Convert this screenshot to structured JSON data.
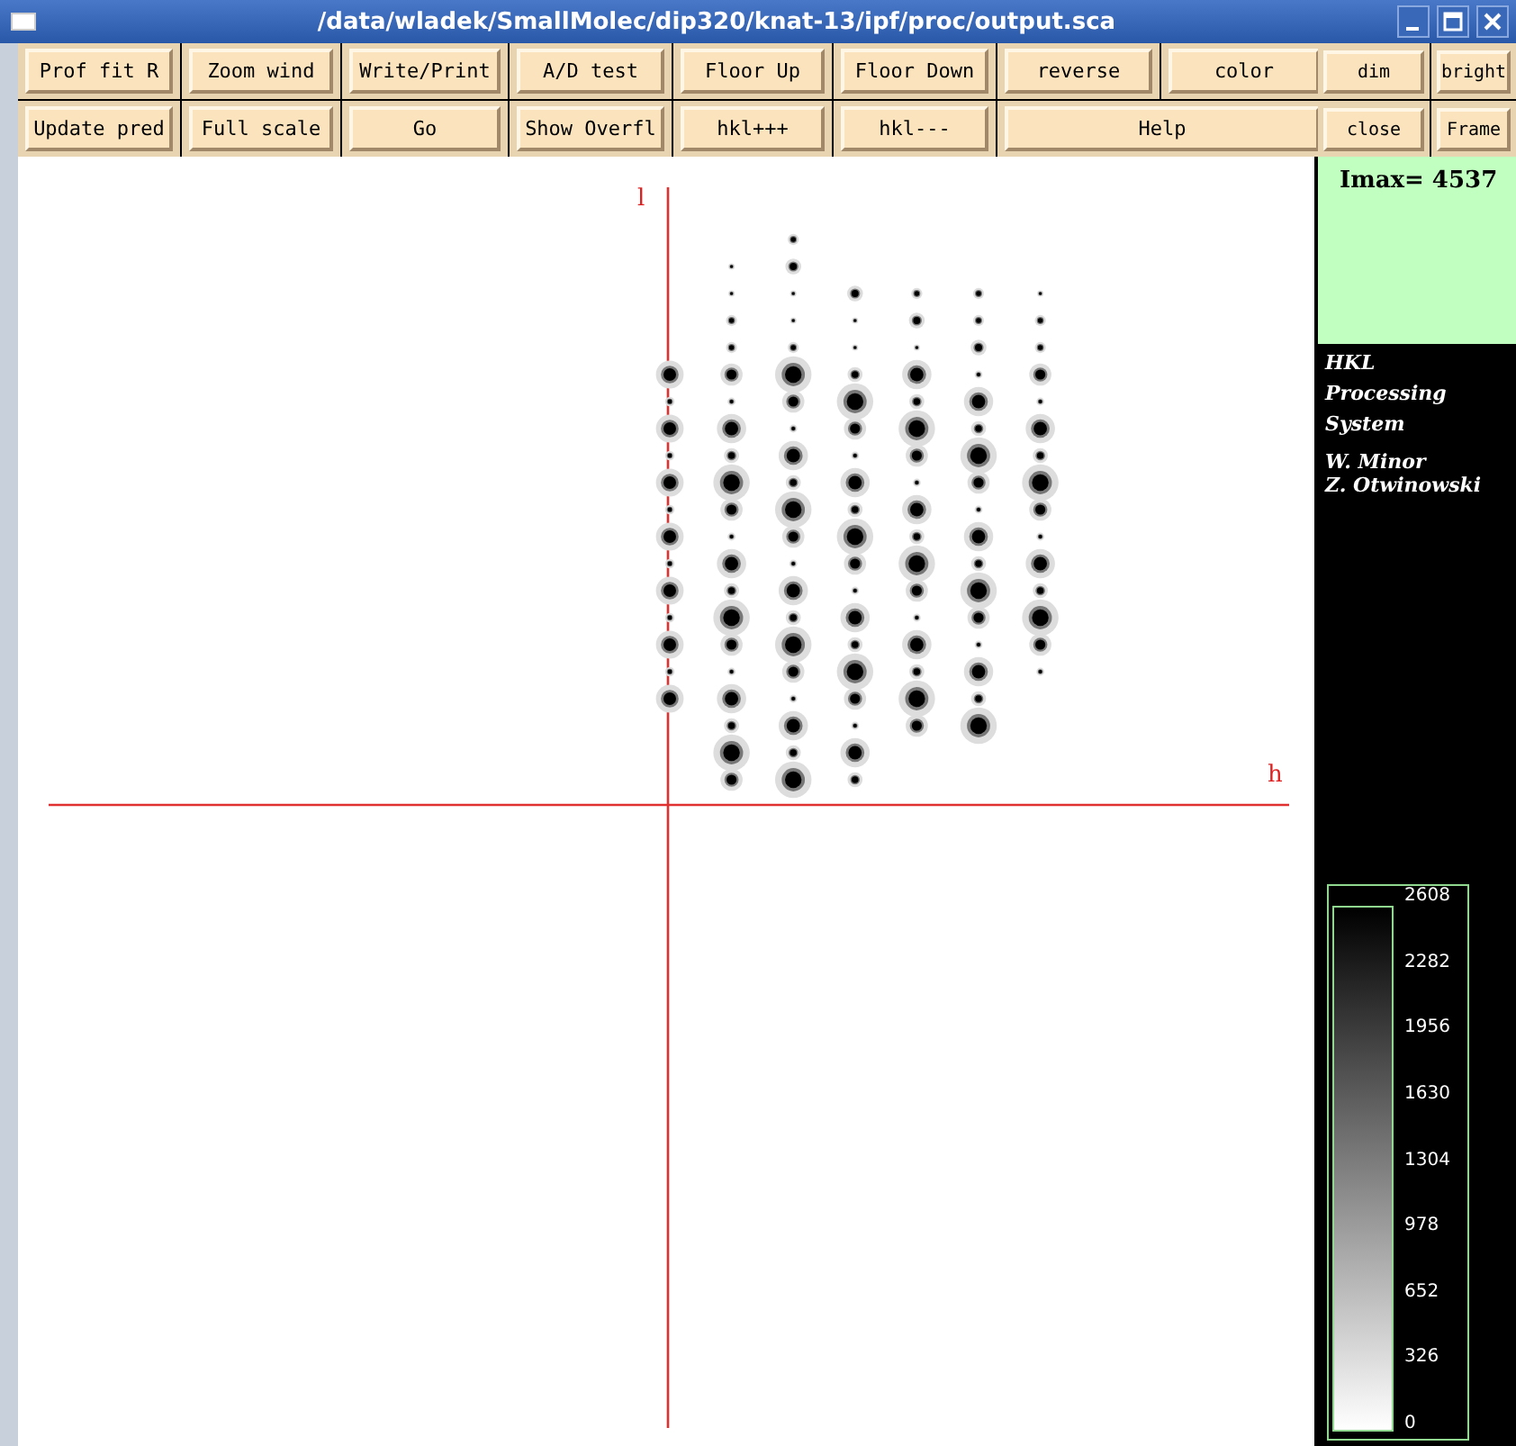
{
  "window": {
    "title": "/data/wladek/SmallMolec/dip320/knat-13/ipf/proc/output.sca"
  },
  "toolbar_rows": [
    [
      {
        "label": "Prof fit R",
        "wide": false
      },
      {
        "label": "Zoom wind",
        "wide": false
      },
      {
        "label": "Write/Print",
        "wide": false
      },
      {
        "label": "A/D test",
        "wide": false
      },
      {
        "label": "Floor Up",
        "wide": false
      },
      {
        "label": "Floor Down",
        "wide": false
      },
      {
        "label": "reverse",
        "wide": false
      },
      {
        "label": "color",
        "wide": false
      }
    ],
    [
      {
        "label": "Update pred",
        "wide": false
      },
      {
        "label": "Full scale",
        "wide": false
      },
      {
        "label": "Go",
        "wide": false
      },
      {
        "label": "Show Overfl",
        "wide": false
      },
      {
        "label": "hkl+++",
        "wide": false
      },
      {
        "label": "hkl---",
        "wide": false
      },
      {
        "label": "Help",
        "wide": true
      }
    ]
  ],
  "side_buttons": [
    [
      "dim",
      "bright"
    ],
    [
      "close",
      "Frame"
    ]
  ],
  "intensity": "Imax= 4537",
  "credits": {
    "title_lines": [
      "HKL",
      "Processing",
      "System"
    ],
    "authors": [
      "W. Minor",
      "Z. Otwinowski"
    ]
  },
  "color_scale": {
    "labels": [
      "2608",
      "2282",
      "1956",
      "1630",
      "1304",
      "978",
      "652",
      "326",
      "0"
    ]
  },
  "plot": {
    "v_axis_label": "l",
    "h_axis_label": "h"
  }
}
